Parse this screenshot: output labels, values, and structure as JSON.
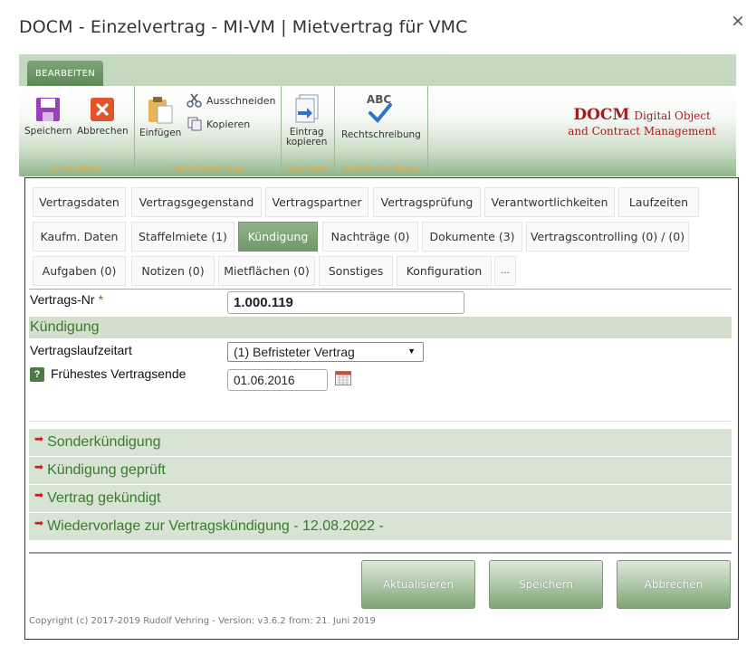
{
  "dialog": {
    "title": "DOCM - Einzelvertrag - MI-VM | Mietvertrag für VMC",
    "close_glyph": "×"
  },
  "ribbon": {
    "tab_label": "BEARBEITEN",
    "groups": {
      "uebergeben": {
        "label": "Übergeben",
        "save": "Speichern",
        "cancel": "Abbrechen"
      },
      "zwischenablage": {
        "label": "Zwischenablage",
        "paste": "Einfügen",
        "cut": "Ausschneiden",
        "copy": "Kopieren"
      },
      "kopieren": {
        "label": "Kopieren",
        "copy_entry_line1": "Eintrag",
        "copy_entry_line2": "kopieren"
      },
      "rechtschreibung": {
        "label": "Rechtschreibung",
        "spell": "Rechtschreibung",
        "abc": "ABC"
      }
    },
    "brand": {
      "line1_bold": "DOCM",
      "line1_rest": "Digital Object",
      "line2": "and Contract Management"
    }
  },
  "tabs": [
    "Vertragsdaten",
    "Vertragsgegenstand",
    "Vertragspartner",
    "Vertragsprüfung",
    "Verantwortlichkeiten",
    "Laufzeiten",
    "Kaufm. Daten",
    "Staffelmiete (1)",
    "Kündigung",
    "Nachträge (0)",
    "Dokumente (3)",
    "Vertragscontrolling (0) / (0)",
    "Aufgaben (0)",
    "Notizen (0)",
    "Mietflächen (0)",
    "Sonstiges",
    "Konfiguration",
    "..."
  ],
  "active_tab": "Kündigung",
  "form": {
    "contract_no_label": "Vertrags-Nr",
    "required_mark": "*",
    "contract_no_value": "1.000.119",
    "section_title": "Kündigung",
    "term_type_label": "Vertragslaufzeitart",
    "term_type_value": "(1) Befristeter Vertrag",
    "earliest_end_label": "Frühestes Vertragsende",
    "earliest_end_value": "01.06.2016",
    "help_glyph": "?"
  },
  "collapsibles": [
    "Sonderkündigung",
    "Kündigung geprüft",
    "Vertrag gekündigt",
    "Wiedervorlage zur Vertragskündigung - 12.08.2022 -"
  ],
  "buttons": {
    "refresh": "Aktualisieren",
    "save": "Speichern",
    "cancel": "Abbrechen"
  },
  "copyright": "Copyright (c) 2017-2019 Rudolf Vehring - Version: v3.6.2 from: 21. Juni 2019",
  "colors": {
    "accent_green": "#6f9868",
    "section_bg": "#d1dfcc",
    "brand_red": "#a51c1c",
    "group_label": "#e9a83a"
  }
}
